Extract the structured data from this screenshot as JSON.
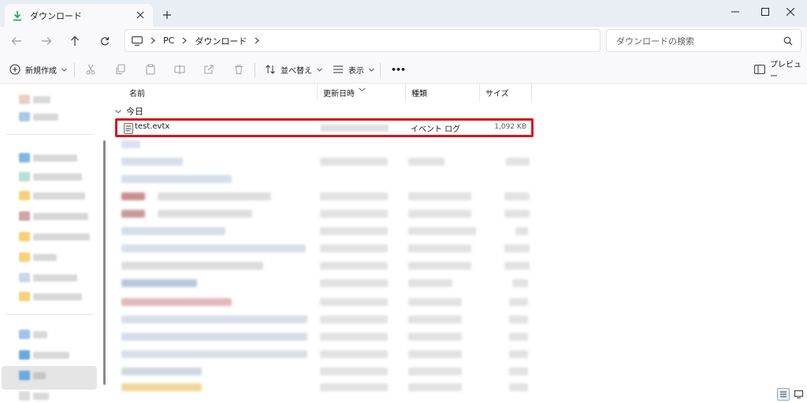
{
  "window": {
    "tab_title": "ダウンロード",
    "new_tab": "+",
    "controls": [
      "minimize",
      "maximize",
      "close"
    ]
  },
  "addressbar": {
    "breadcrumb": [
      "PC",
      "ダウンロード"
    ],
    "search_placeholder": "ダウンロードの検索"
  },
  "toolbar": {
    "new_label": "新規作成",
    "sort_label": "並べ替え",
    "view_label": "表示",
    "more_label": "•••",
    "preview_label": "プレビュー"
  },
  "columns": {
    "name": "名前",
    "modified": "更新日時",
    "type": "種類",
    "size": "サイズ"
  },
  "group": {
    "label": "今日"
  },
  "highlighted_file": {
    "name": "test.evtx",
    "type": "イベント ログ",
    "size": "1,092 KB"
  },
  "colors": {
    "highlight_border": "#d7161d",
    "accent": "#1aa05d",
    "folder": "#f5c543"
  }
}
